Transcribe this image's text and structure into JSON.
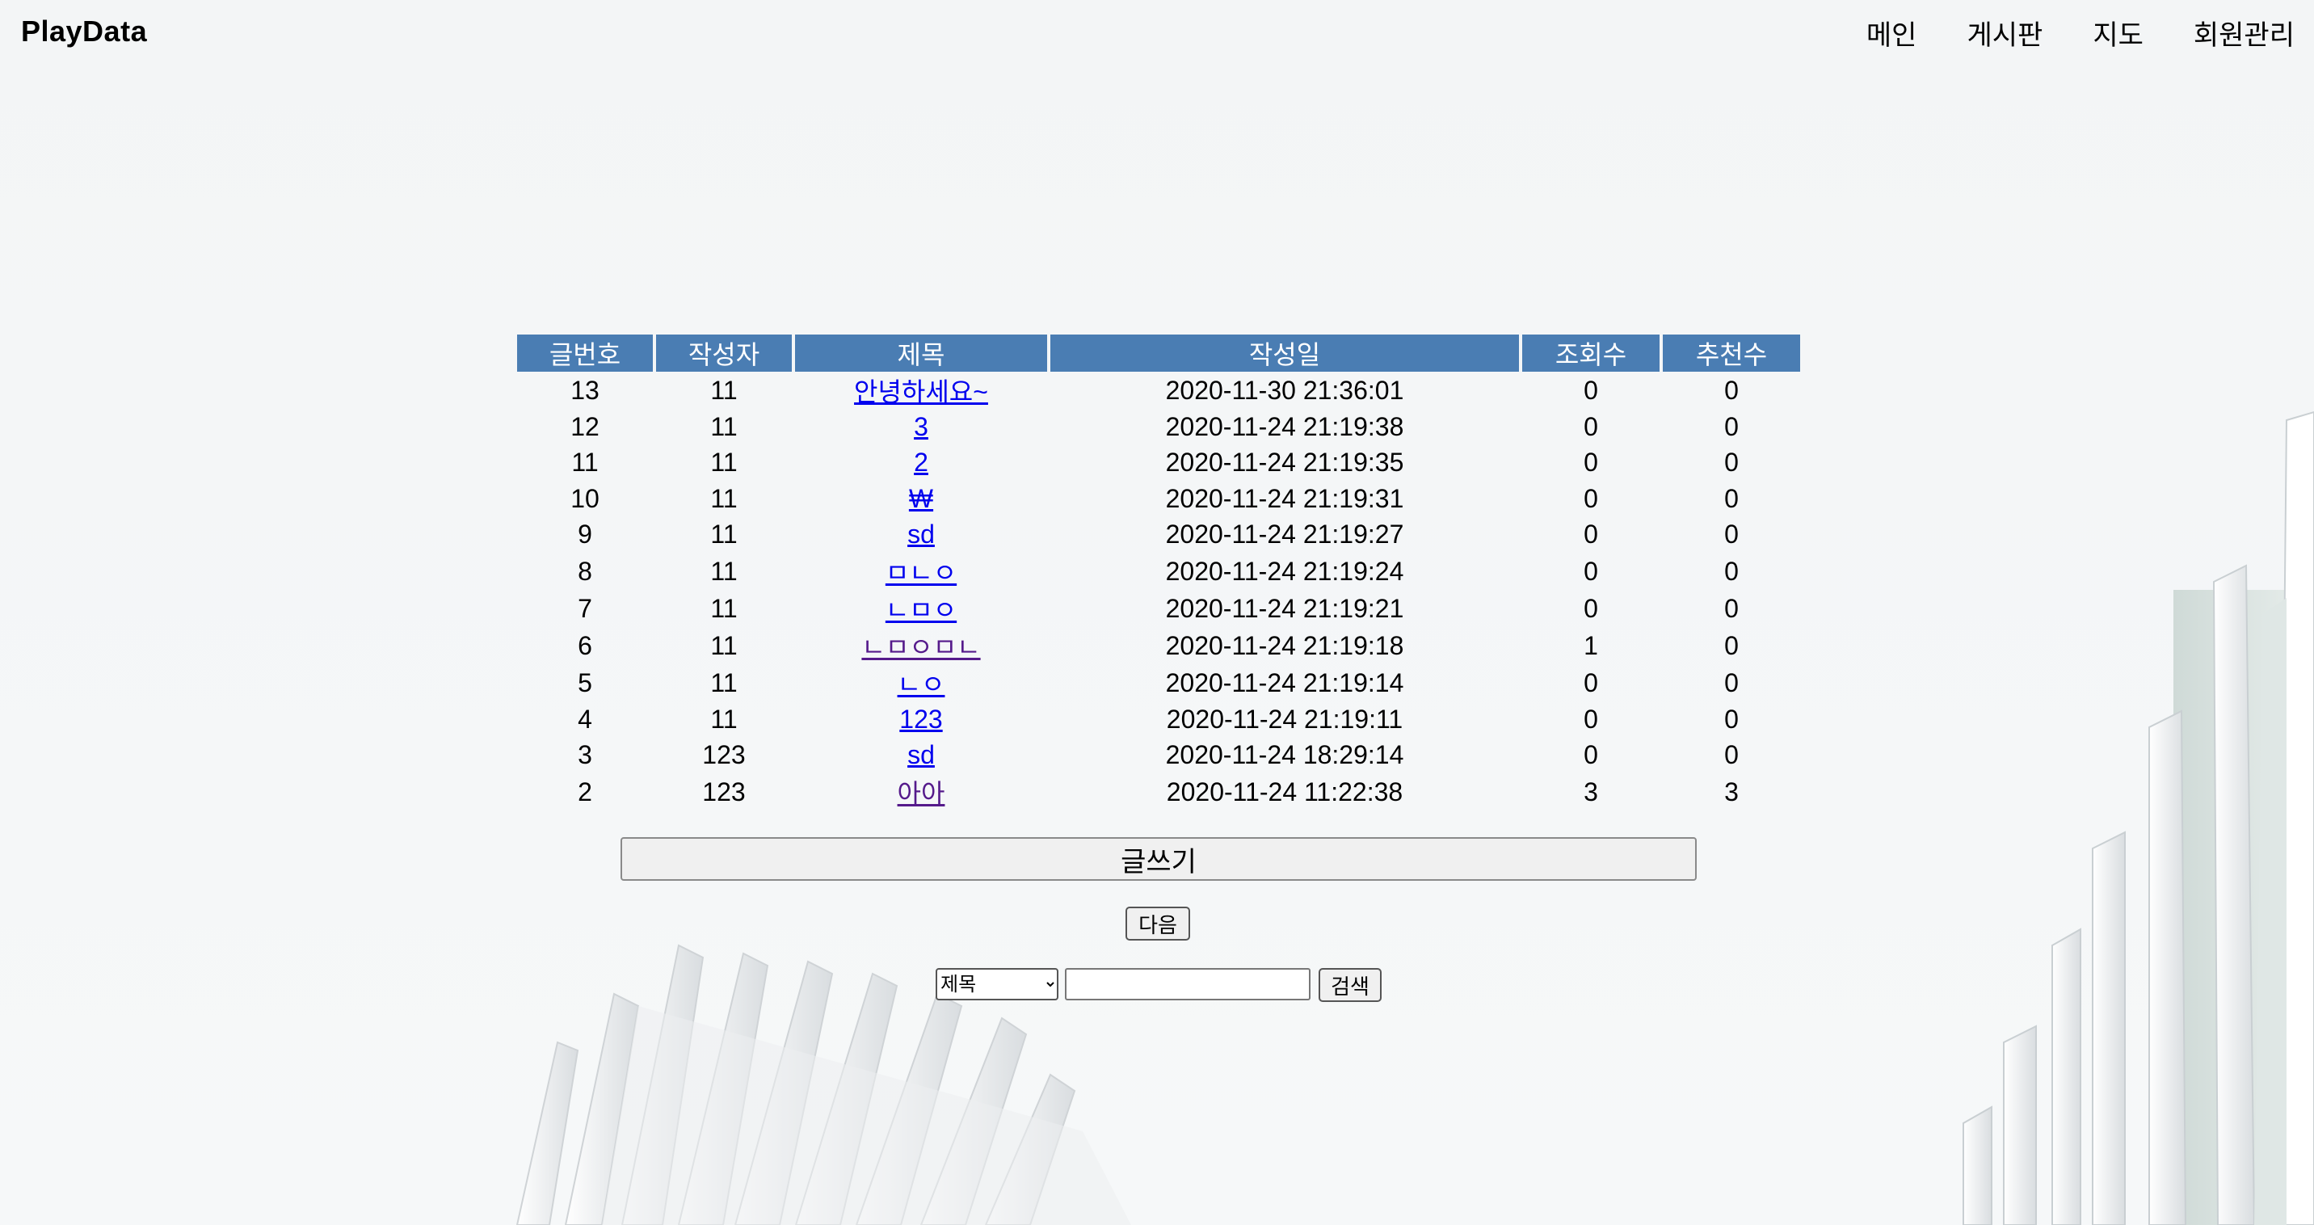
{
  "header": {
    "brand": "PlayData",
    "nav": [
      "메인",
      "게시판",
      "지도",
      "회원관리"
    ]
  },
  "board": {
    "columns": [
      "글번호",
      "작성자",
      "제목",
      "작성일",
      "조회수",
      "추천수"
    ],
    "rows": [
      {
        "no": "13",
        "author": "11",
        "title": "안녕하세요~",
        "date": "2020-11-30 21:36:01",
        "views": "0",
        "likes": "0"
      },
      {
        "no": "12",
        "author": "11",
        "title": "3",
        "date": "2020-11-24 21:19:38",
        "views": "0",
        "likes": "0"
      },
      {
        "no": "11",
        "author": "11",
        "title": "2",
        "date": "2020-11-24 21:19:35",
        "views": "0",
        "likes": "0"
      },
      {
        "no": "10",
        "author": "11",
        "title": "₩",
        "date": "2020-11-24 21:19:31",
        "views": "0",
        "likes": "0"
      },
      {
        "no": "9",
        "author": "11",
        "title": "sd",
        "date": "2020-11-24 21:19:27",
        "views": "0",
        "likes": "0"
      },
      {
        "no": "8",
        "author": "11",
        "title": "ㅁㄴㅇ",
        "date": "2020-11-24 21:19:24",
        "views": "0",
        "likes": "0"
      },
      {
        "no": "7",
        "author": "11",
        "title": "ㄴㅁㅇ",
        "date": "2020-11-24 21:19:21",
        "views": "0",
        "likes": "0"
      },
      {
        "no": "6",
        "author": "11",
        "title": "ㄴㅁㅇㅁㄴ",
        "date": "2020-11-24 21:19:18",
        "views": "1",
        "likes": "0"
      },
      {
        "no": "5",
        "author": "11",
        "title": "ㄴㅇ",
        "date": "2020-11-24 21:19:14",
        "views": "0",
        "likes": "0"
      },
      {
        "no": "4",
        "author": "11",
        "title": "123",
        "date": "2020-11-24 21:19:11",
        "views": "0",
        "likes": "0"
      },
      {
        "no": "3",
        "author": "123",
        "title": "sd",
        "date": "2020-11-24 18:29:14",
        "views": "0",
        "likes": "0"
      },
      {
        "no": "2",
        "author": "123",
        "title": "아아",
        "date": "2020-11-24 11:22:38",
        "views": "3",
        "likes": "3"
      }
    ]
  },
  "buttons": {
    "write": "글쓰기",
    "next": "다음",
    "search": "검색"
  },
  "search": {
    "select_value": "제목",
    "input_value": ""
  },
  "colors": {
    "header_bg": "#4a7db3",
    "link": "#0000ee",
    "visited_link": "#551a8b"
  }
}
